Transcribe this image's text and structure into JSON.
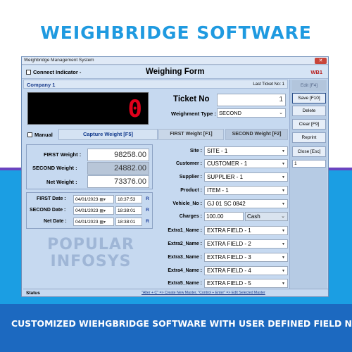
{
  "headline": "WEIGHBRIDGE SOFTWARE",
  "tagline": "CUSTOMIZED WIEHGBRIDGE SOFTWARE WITH USER DEFINED FIELD NAME",
  "window": {
    "title": "Weighbridge Management System",
    "connect_indicator": "Connect Indicator -",
    "form_title": "Weighing Form",
    "wb": "WB1",
    "company": "Company 1",
    "last_ticket": "Last Ticket No: 1",
    "display_value": "0",
    "ticket_label": "Ticket No",
    "ticket_value": "1",
    "weighment_type_label": "Weighment Type :",
    "weighment_type_value": "SECOND",
    "manual_label": "Manual",
    "capture_weight": "Capture Weight [F5]",
    "first_weight_btn": "FIRST Weight [F1]",
    "second_weight_btn": "SECOND Weight [F2]",
    "weights": {
      "first_label": "FIRST Weight :",
      "first_value": "98258.00",
      "second_label": "SECOND Weight :",
      "second_value": "24882.00",
      "net_label": "Net Weight :",
      "net_value": "73376.00"
    },
    "dates": {
      "first_label": "FIRST Date :",
      "first_date": "04/01/2023",
      "first_time": "18:37:53",
      "second_label": "SECOND Date :",
      "second_date": "04/01/2023",
      "second_time": "18:38:01",
      "net_label": "Net Date :",
      "net_date": "04/01/2023",
      "net_time": "18:38:01",
      "r": "R"
    },
    "watermark": [
      "POPULAR",
      "INFOSYS"
    ],
    "fields": {
      "site_label": "Site :",
      "site_value": "SITE - 1",
      "customer_label": "Customer :",
      "customer_value": "CUSTOMER - 1",
      "supplier_label": "Supplier :",
      "supplier_value": "SUPPLIER - 1",
      "product_label": "Product :",
      "product_value": "ITEM - 1",
      "vehicle_label": "Vehicle_No :",
      "vehicle_value": "GJ 01 SC 0842",
      "charges_label": "Charges :",
      "charges_value": "100.00",
      "charges_mode": "Cash",
      "extra1_label": "Extra1_Name :",
      "extra1_value": "EXTRA FIELD - 1",
      "extra2_label": "Extra2_Name :",
      "extra2_value": "EXTRA FIELD - 2",
      "extra3_label": "Extra3_Name :",
      "extra3_value": "EXTRA FIELD - 3",
      "extra4_label": "Extra4_Name :",
      "extra4_value": "EXTRA FIELD - 4",
      "extra5_label": "Extra5_Name :",
      "extra5_value": "EXTRA FIELD - 5"
    },
    "buttons": {
      "edit": "Edit [F4]",
      "save": "Save [F10]",
      "delete": "Delete",
      "clear": "Clear [F9]",
      "reprint": "Reprint",
      "close": "Close [Esc]",
      "side_input": "1"
    },
    "status": "Status",
    "hint": "\"Alter + C\" => Create New Master, \"Control + Enter\" => Edit Selected Master"
  }
}
